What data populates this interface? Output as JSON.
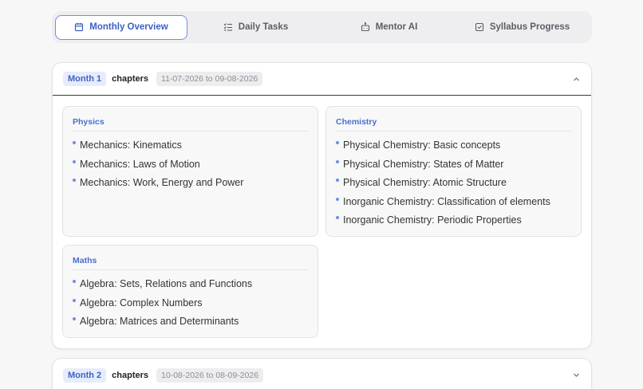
{
  "tabs": [
    {
      "label": "Monthly Overview",
      "icon": "calendar-icon",
      "active": true
    },
    {
      "label": "Daily Tasks",
      "icon": "task-list-icon",
      "active": false
    },
    {
      "label": "Mentor AI",
      "icon": "robot-icon",
      "active": false
    },
    {
      "label": "Syllabus Progress",
      "icon": "checkbox-icon",
      "active": false
    }
  ],
  "months": [
    {
      "badge": "Month 1",
      "label": "chapters",
      "range": "11-07-2026 to 09-08-2026",
      "expanded": true,
      "subjects": [
        {
          "name": "Physics",
          "chapters": [
            "Mechanics: Kinematics",
            "Mechanics: Laws of Motion",
            "Mechanics: Work, Energy and Power"
          ]
        },
        {
          "name": "Chemistry",
          "chapters": [
            "Physical Chemistry: Basic concepts",
            "Physical Chemistry: States of Matter",
            "Physical Chemistry: Atomic Structure",
            "Inorganic Chemistry: Classification of elements",
            "Inorganic Chemistry: Periodic Properties"
          ]
        },
        {
          "name": "Maths",
          "chapters": [
            "Algebra: Sets, Relations and Functions",
            "Algebra: Complex Numbers",
            "Algebra: Matrices and Determinants"
          ]
        }
      ]
    },
    {
      "badge": "Month 2",
      "label": "chapters",
      "range": "10-08-2026 to 08-09-2026",
      "expanded": false
    }
  ],
  "colors": {
    "accent": "#3d63c9",
    "badge_bg": "#e6ecfb"
  }
}
